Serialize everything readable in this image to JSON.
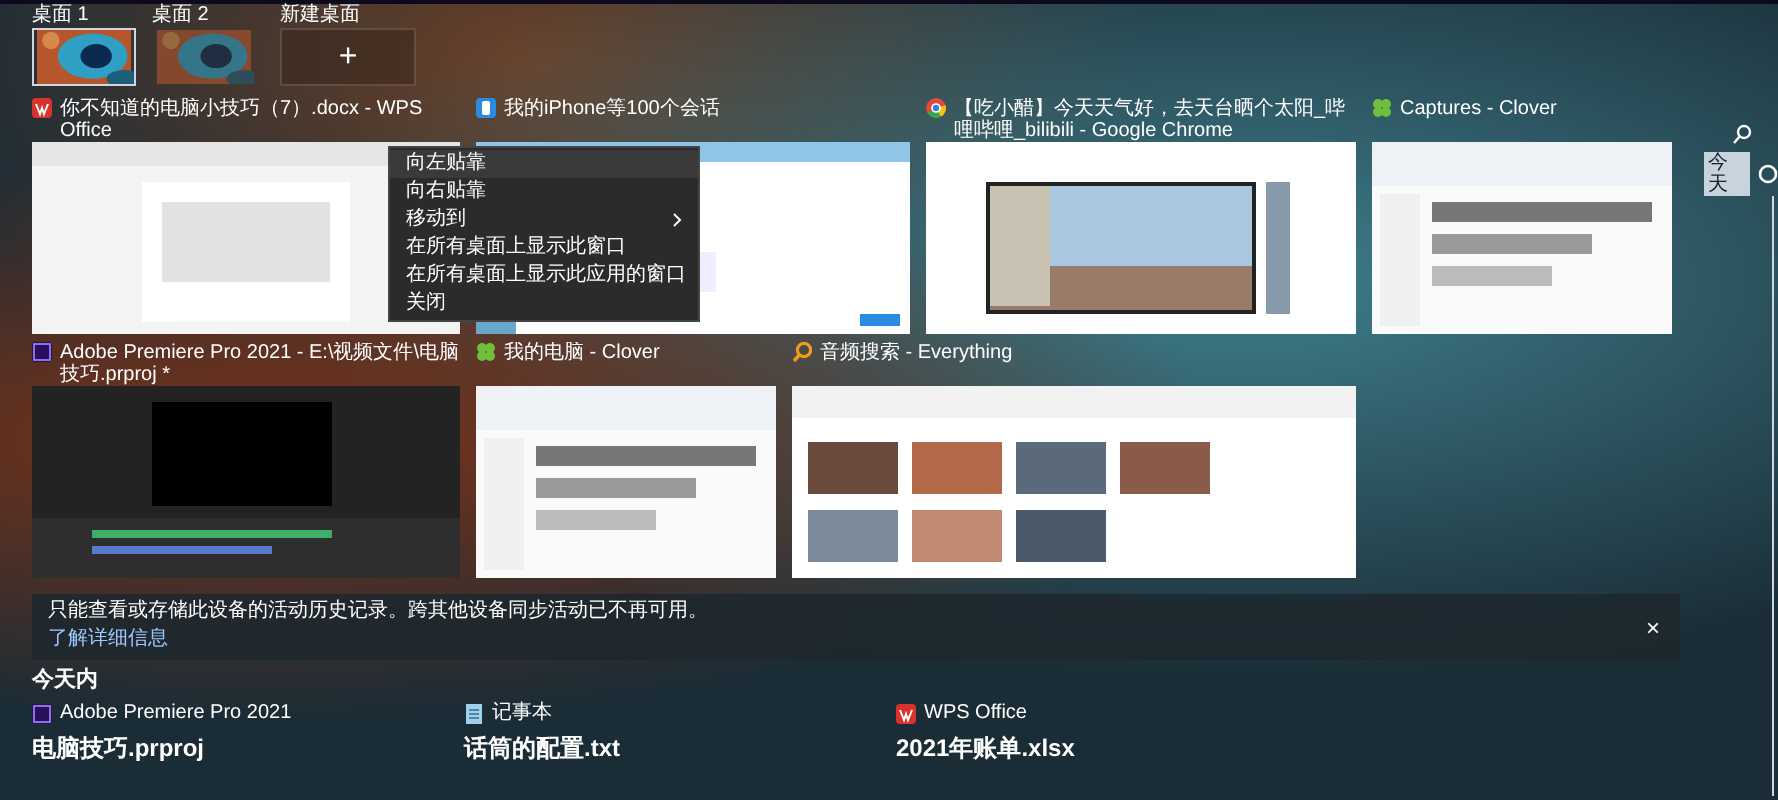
{
  "desktops": [
    {
      "label": "桌面 1",
      "selected": true
    },
    {
      "label": "桌面 2",
      "selected": false
    }
  ],
  "new_desktop": {
    "label": "新建桌面",
    "icon": "+"
  },
  "window_rows": [
    [
      {
        "title": "你不知道的电脑小技巧（7）.docx - WPS Office",
        "kind": "wps",
        "context_menu": [
          {
            "label": "向左贴靠",
            "submenu": false,
            "selected": true
          },
          {
            "label": "向右贴靠",
            "submenu": false,
            "selected": false
          },
          {
            "label": "移动到",
            "submenu": true,
            "selected": false
          },
          {
            "label": "在所有桌面上显示此窗口",
            "submenu": false,
            "selected": false
          },
          {
            "label": "在所有桌面上显示此应用的窗口",
            "submenu": false,
            "selected": false
          },
          {
            "label": "关闭",
            "submenu": false,
            "selected": false
          }
        ]
      },
      {
        "title": "我的iPhone等100个会话",
        "kind": "phone"
      },
      {
        "title": "【吃小醋】今天天气好，去天台晒个太阳_哔哩哔哩_bilibili - Google Chrome",
        "kind": "chrome"
      },
      {
        "title": "Captures - Clover",
        "kind": "clover"
      }
    ],
    [
      {
        "title": "Adobe Premiere Pro 2021 - E:\\视频文件\\电脑技巧.prproj *",
        "kind": "premiere"
      },
      {
        "title": "我的电脑 - Clover",
        "kind": "clover"
      },
      {
        "title": "音频搜索 - Everything",
        "kind": "everything"
      }
    ]
  ],
  "timeline": {
    "label": "今天"
  },
  "notice": {
    "text": "只能查看或存储此设备的活动历史记录。跨其他设备同步活动已不再可用。",
    "link": "了解详细信息",
    "close": "×"
  },
  "activity": {
    "heading": "今天内",
    "items": [
      {
        "kind": "premiere",
        "app_name": "Adobe Premiere Pro 2021",
        "title": "电脑技巧.prproj"
      },
      {
        "kind": "notepad",
        "app_name": "记事本",
        "title": "话筒的配置.txt"
      },
      {
        "kind": "wps",
        "app_name": "WPS Office",
        "title": "2021年账单.xlsx"
      }
    ]
  }
}
